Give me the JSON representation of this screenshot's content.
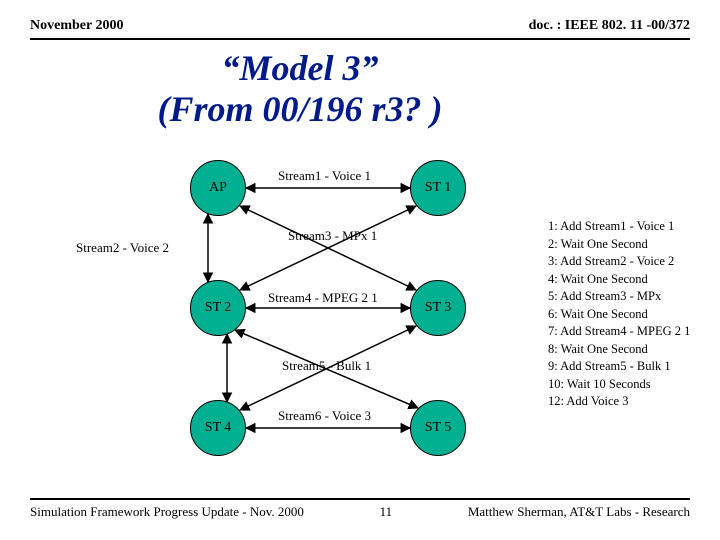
{
  "header": {
    "left": "November 2000",
    "right": "doc. : IEEE 802. 11 -00/372"
  },
  "title_line1": "“Model 3”",
  "title_line2": "(From 00/196 r3? )",
  "nodes": {
    "ap": "AP",
    "st1": "ST 1",
    "st2": "ST 2",
    "st3": "ST 3",
    "st4": "ST 4",
    "st5": "ST 5"
  },
  "streams": {
    "s1": "Stream1 - Voice 1",
    "s2": "Stream2 - Voice 2",
    "s3": "Stream3 - MPx 1",
    "s4": "Stream4 - MPEG 2 1",
    "s5": "Stream5 - Bulk 1",
    "s6": "Stream6 - Voice 3"
  },
  "steps": [
    "1: Add Stream1 - Voice 1",
    "2: Wait One Second",
    "3: Add Stream2 - Voice 2",
    "4: Wait One Second",
    "5: Add Stream3 - MPx",
    "6: Wait One Second",
    "7: Add Stream4 - MPEG 2 1",
    "8: Wait One Second",
    "9: Add Stream5 - Bulk 1",
    "10: Wait 10 Seconds",
    "12: Add Voice 3"
  ],
  "footer": {
    "left": "Simulation Framework Progress Update - Nov. 2000",
    "center": "11",
    "right": "Matthew Sherman, AT&T Labs - Research"
  }
}
